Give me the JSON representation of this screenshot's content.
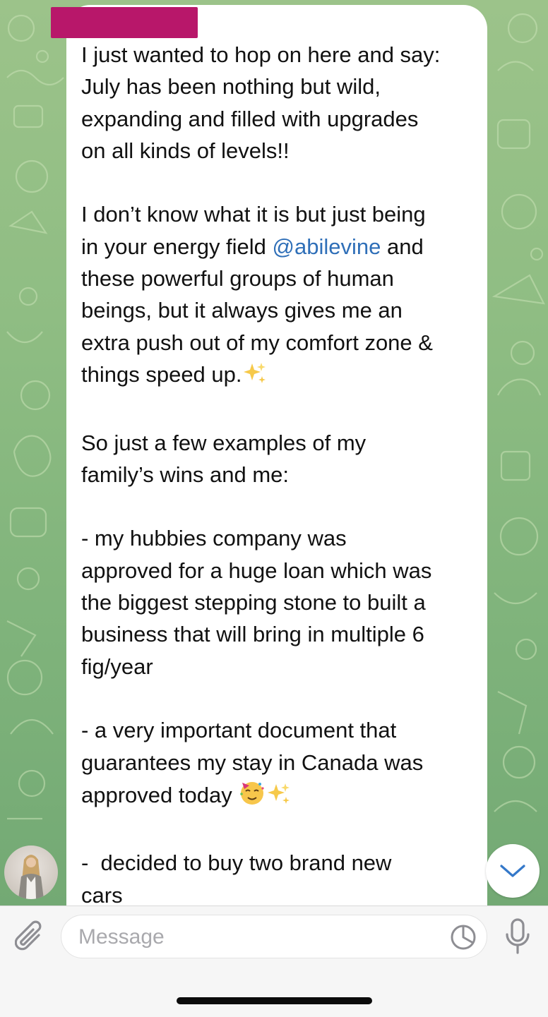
{
  "message": {
    "sender_redacted": true,
    "paragraphs": [
      "I just wanted to hop on here and say:\nJuly has been nothing but wild,\nexpanding and filled with upgrades\non all kinds of levels!!",
      "I don’t know what it is but just being\nin your energy field ",
      "@abilevine",
      " and\nthese powerful groups of human\nbeings, but it always gives me an\nextra push out of my comfort zone &\nthings speed up.",
      "So just a few examples of my\nfamily’s wins and me:",
      "- my hubbies company was\napproved for a huge loan which was\nthe biggest stepping stone to built a\nbusiness that will bring in multiple 6\nfig/year",
      "- a very important document that\nguarantees my stay in Canada was\napproved today ",
      "-  decided to buy two brand new\ncars"
    ],
    "mention": "@abilevine",
    "emojis": [
      "sparkles-emoji",
      "partying-face-emoji",
      "sparkles-emoji"
    ]
  },
  "composer": {
    "placeholder": "Message"
  },
  "colors": {
    "chat_background": "#8fbd83",
    "bubble": "#ffffff",
    "mention": "#2f6fb8",
    "sender_redaction": "#b8176a",
    "composer_bg": "#f6f6f6",
    "icon_grey": "#8e8e93",
    "accent_blue": "#3478c9"
  },
  "icons": {
    "attach": "paperclip-icon",
    "sticker": "sticker-icon",
    "mic": "microphone-icon",
    "scroll_down": "chevron-down-icon"
  }
}
